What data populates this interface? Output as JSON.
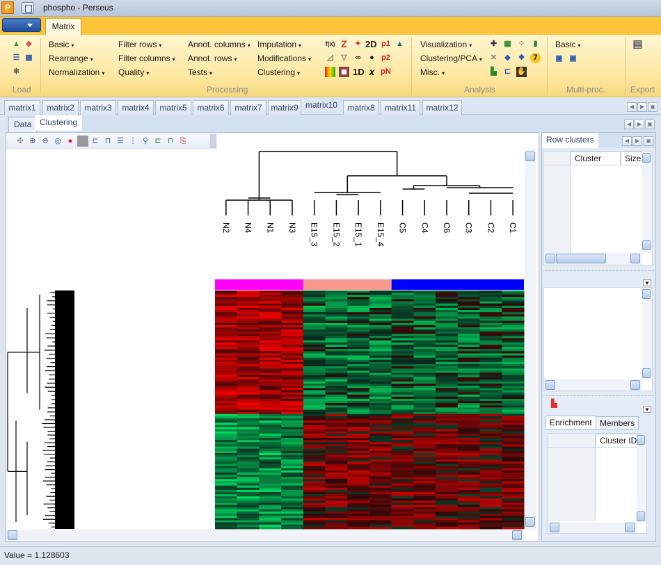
{
  "window": {
    "app_icon": "P",
    "title": "phospho  -  Perseus"
  },
  "ribbon": {
    "active_tab": "Matrix",
    "groups": {
      "load": "Load",
      "processing": "Processing",
      "analysis": "Analysis",
      "multiproc": "Multi-proc.",
      "export": "Export"
    },
    "processing_col1": [
      "Basic",
      "Rearrange",
      "Normalization"
    ],
    "processing_col2": [
      "Filter rows",
      "Filter columns",
      "Quality"
    ],
    "processing_col3": [
      "Annot. columns",
      "Annot. rows",
      "Tests"
    ],
    "processing_col4": [
      "Imputation",
      "Modifications",
      "Clustering"
    ],
    "analysis_col1": [
      "Visualization",
      "Clustering/PCA",
      "Misc."
    ],
    "multiproc_col1": [
      "Basic"
    ],
    "icon_glyphs": {
      "fx": "f(x)",
      "z": "Z",
      "p1": "p1",
      "p2": "p2",
      "pn": "pN",
      "d2": "2D",
      "d1": "1D",
      "x": "x",
      "seven": "7"
    }
  },
  "matrix_tabs": [
    "matrix1",
    "matrix2",
    "matrix3",
    "matrix4",
    "matrix5",
    "matrix6",
    "matrix7",
    "matrix9",
    "matrix10",
    "matrix8",
    "matrix11",
    "matrix12"
  ],
  "active_matrix_tab": "matrix10",
  "sub_tabs": [
    "Data",
    "Clustering"
  ],
  "active_sub_tab": "Clustering",
  "heatmap": {
    "column_labels": [
      "N2",
      "N4",
      "N1",
      "N3",
      "E15_3",
      "E15_2",
      "E15_1",
      "E15_4",
      "C5",
      "C4",
      "C6",
      "C3",
      "C2",
      "C1"
    ],
    "group_colors": [
      "#ff00ff",
      "#f4998c",
      "#0000ff"
    ],
    "row_cluster_split": 0.52
  },
  "right_panel": {
    "title": "Row clusters",
    "grid_headers": [
      "Cluster",
      "Size"
    ],
    "bottom_tabs": [
      "Enrichment",
      "Members"
    ],
    "bottom_grid_header": "Cluster ID"
  },
  "status": {
    "text": "Value = 1.128603"
  }
}
